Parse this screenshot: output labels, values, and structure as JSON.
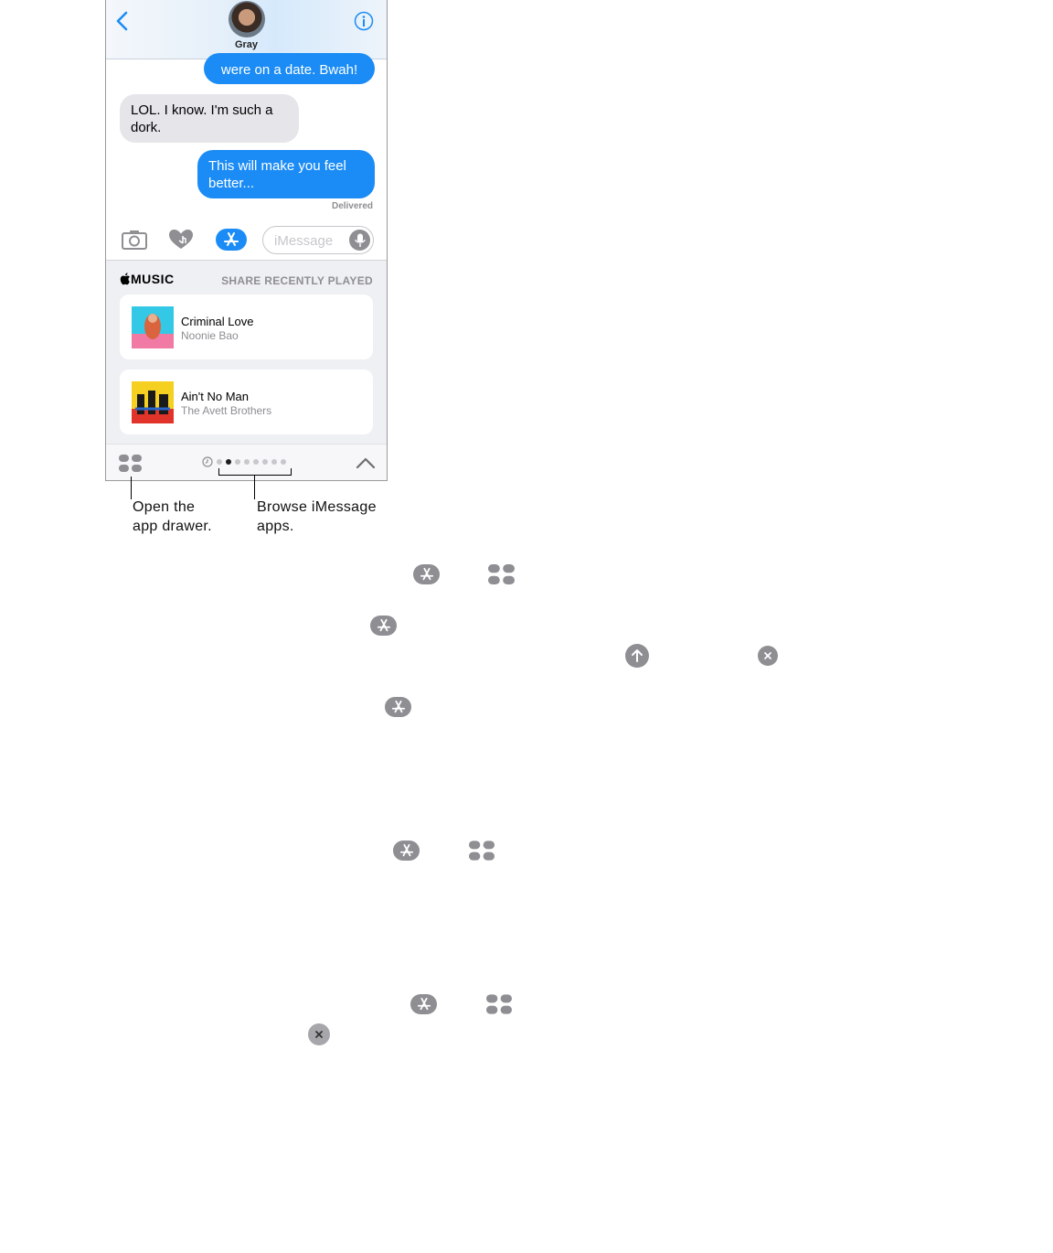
{
  "conversation": {
    "contact_name": "Gray",
    "messages": [
      {
        "direction": "outgoing",
        "text": "were on a date. Bwah!"
      },
      {
        "direction": "incoming",
        "line1": "LOL. I know. I'm such a",
        "line2": "dork."
      },
      {
        "direction": "outgoing",
        "line1": "This will make you feel",
        "line2": "better..."
      }
    ],
    "delivered_label": "Delivered"
  },
  "input_bar": {
    "placeholder": "iMessage"
  },
  "music_app": {
    "logo_text": "MUSIC",
    "section_label": "SHARE RECENTLY PLAYED",
    "songs": [
      {
        "title": "Criminal Love",
        "artist": "Noonie Bao"
      },
      {
        "title": "Ain't No Man",
        "artist": "The Avett Brothers"
      }
    ]
  },
  "app_strip": {
    "page_count": 8,
    "active_page": 1
  },
  "callouts": {
    "open_drawer": {
      "line1": "Open the",
      "line2": "app drawer."
    },
    "browse_apps": {
      "line1": "Browse iMessage",
      "line2": "apps."
    }
  },
  "colors": {
    "accent_blue": "#1b8cf5",
    "incoming_bubble": "#e5e5ea",
    "icon_gray": "#8e8e93"
  },
  "icons": [
    "back-icon",
    "info-icon",
    "camera-icon",
    "digital-touch-icon",
    "app-store-icon",
    "microphone-icon",
    "apple-logo-icon",
    "app-drawer-icon",
    "clock-icon",
    "chevron-up-icon",
    "upload-arrow-icon",
    "close-icon"
  ]
}
